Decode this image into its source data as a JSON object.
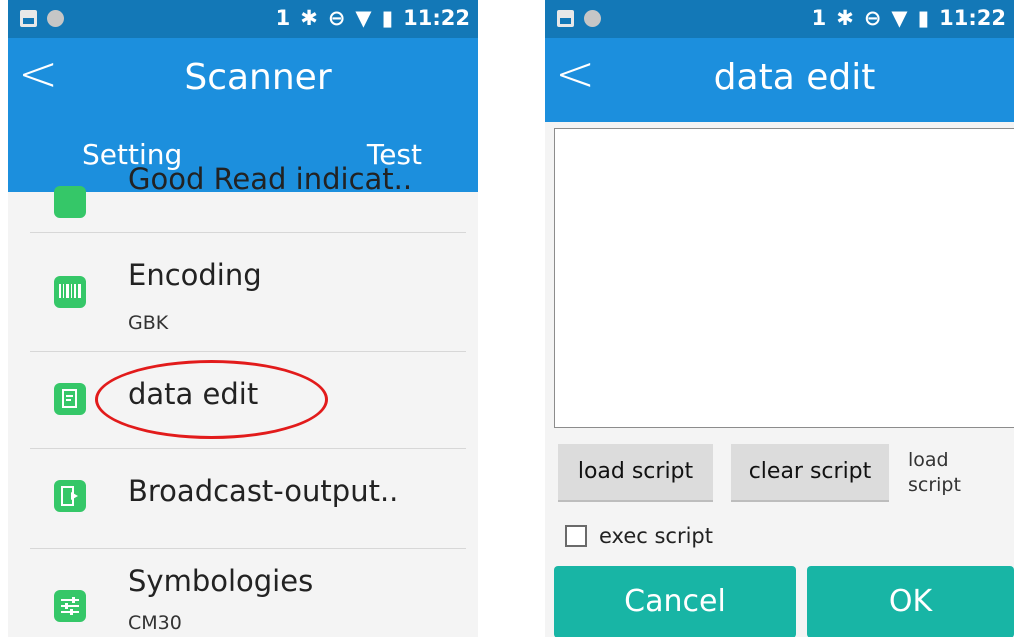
{
  "status_bar": {
    "sim": "1",
    "bt": "✱",
    "time": "11:22"
  },
  "left": {
    "title": "Scanner",
    "tabs": {
      "setting": "Setting",
      "test": "Test"
    },
    "items": [
      {
        "label": "Good Read indicat..",
        "sub": ""
      },
      {
        "label": "Encoding",
        "sub": "GBK"
      },
      {
        "label": "data edit",
        "sub": ""
      },
      {
        "label": "Broadcast-output..",
        "sub": ""
      },
      {
        "label": "Symbologies",
        "sub": "CM30"
      }
    ]
  },
  "right": {
    "title": "data edit",
    "editor_value": "",
    "buttons": {
      "load_script": "load script",
      "clear_script": "clear script"
    },
    "side_note": "load script",
    "exec_script": "exec script",
    "exec_checked": false,
    "cancel": "Cancel",
    "ok": "OK"
  },
  "colors": {
    "status_bar": "#1378b7",
    "app_bar": "#1c8fdd",
    "icon_green": "#35c768",
    "accent_teal": "#18b5a5",
    "highlight_red": "#e21b1b"
  }
}
